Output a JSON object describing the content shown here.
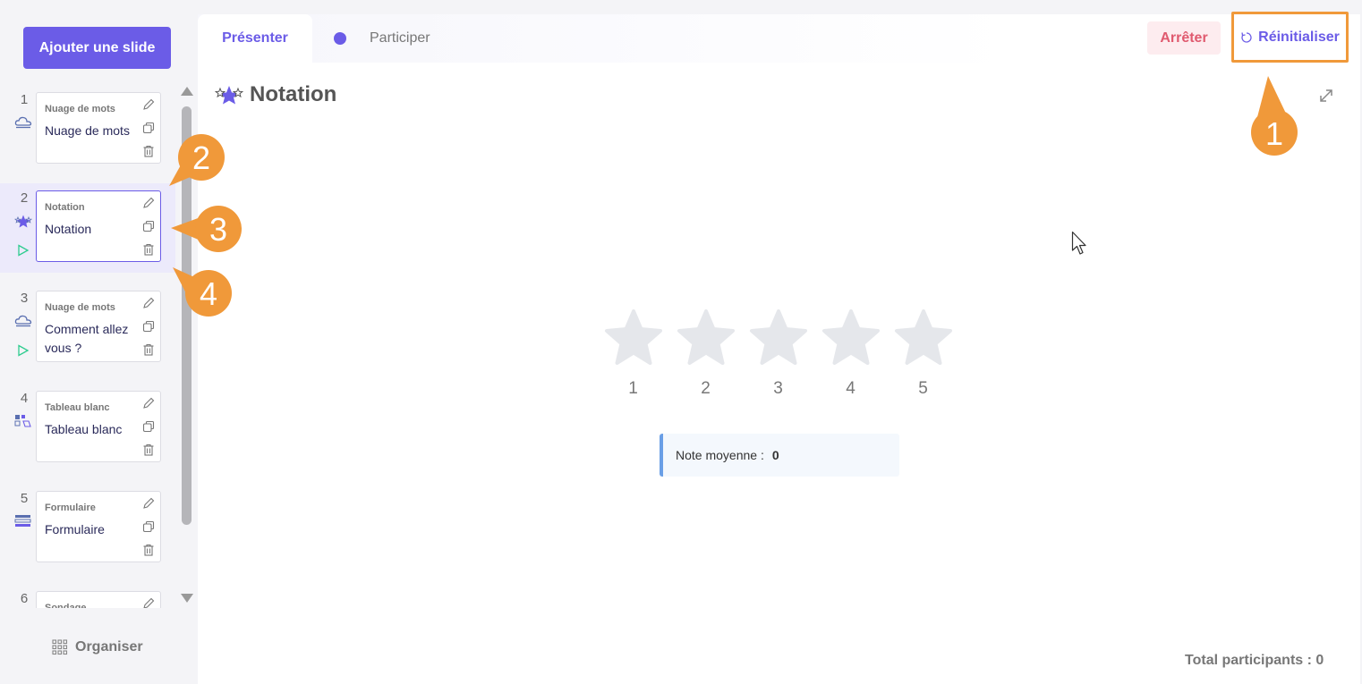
{
  "sidebar": {
    "add_slide_label": "Ajouter une slide",
    "organise_label": "Organiser",
    "slides": [
      {
        "number": "1",
        "type": "Nuage de mots",
        "title": "Nuage de mots",
        "icon": "cloud-icon"
      },
      {
        "number": "2",
        "type": "Notation",
        "title": "Notation",
        "icon": "stars-icon"
      },
      {
        "number": "3",
        "type": "Nuage de mots",
        "title": "Comment allez vous ?",
        "icon": "cloud-icon"
      },
      {
        "number": "4",
        "type": "Tableau blanc",
        "title": "Tableau blanc",
        "icon": "whiteboard-icon"
      },
      {
        "number": "5",
        "type": "Formulaire",
        "title": "Formulaire",
        "icon": "form-icon"
      },
      {
        "number": "6",
        "type": "Sondage",
        "title": "",
        "icon": "poll-icon"
      }
    ]
  },
  "topbar": {
    "tab_present": "Présenter",
    "tab_participate": "Participer",
    "stop_label": "Arrêter",
    "reset_label": "Réinitialiser"
  },
  "main": {
    "heading": "Notation",
    "stars": [
      "1",
      "2",
      "3",
      "4",
      "5"
    ],
    "average_label": "Note moyenne :",
    "average_value": "0",
    "total_label": "Total participants : 0"
  },
  "callouts": [
    "1",
    "2",
    "3",
    "4"
  ],
  "colors": {
    "accent": "#6b5ce7",
    "callout": "#f0993a",
    "stop": "#e05a6f",
    "star": "#e5e7eb"
  }
}
